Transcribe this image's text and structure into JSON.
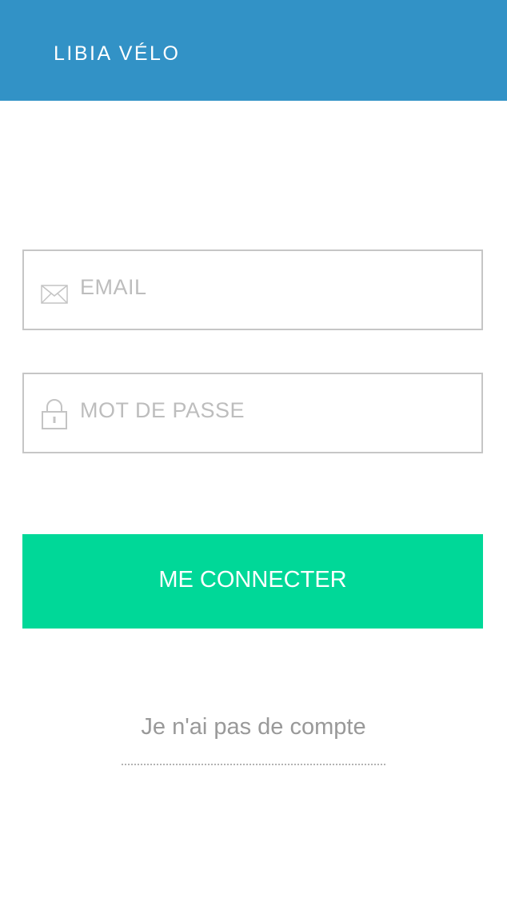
{
  "header": {
    "brand": "LIBIA VÉLO"
  },
  "form": {
    "email": {
      "placeholder": "EMAIL",
      "value": "",
      "icon": "envelope-icon"
    },
    "password": {
      "placeholder": "MOT DE PASSE",
      "value": "",
      "icon": "lock-icon"
    },
    "submit_label": "ME CONNECTER"
  },
  "signup": {
    "label": "Je n'ai pas de compte"
  },
  "colors": {
    "header": "#3292c6",
    "primary_button": "#00d898",
    "field_border": "#c6c6c6",
    "placeholder": "#bdbdbd",
    "link": "#999999"
  }
}
